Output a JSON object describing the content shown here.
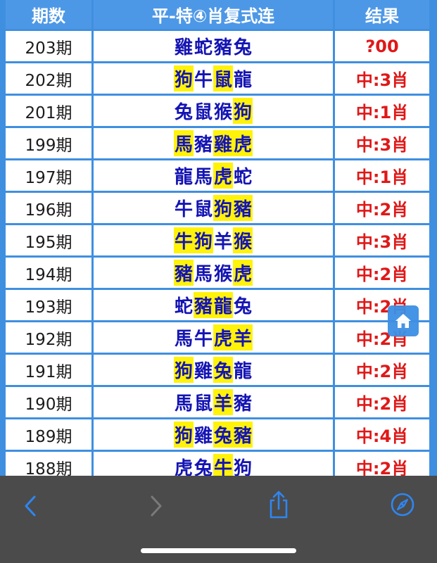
{
  "table": {
    "headers": [
      "期数",
      "平-特④肖复式连",
      "结果"
    ],
    "rows": [
      {
        "issue": "203期",
        "zodiacs": [
          {
            "c": "雞",
            "hl": false
          },
          {
            "c": "蛇",
            "hl": false
          },
          {
            "c": "豬",
            "hl": false
          },
          {
            "c": "兔",
            "hl": false
          }
        ],
        "result": "?00"
      },
      {
        "issue": "202期",
        "zodiacs": [
          {
            "c": "狗",
            "hl": true
          },
          {
            "c": "牛",
            "hl": false
          },
          {
            "c": "鼠",
            "hl": true
          },
          {
            "c": "龍",
            "hl": false
          }
        ],
        "result": "中:3肖"
      },
      {
        "issue": "201期",
        "zodiacs": [
          {
            "c": "兔",
            "hl": false
          },
          {
            "c": "鼠",
            "hl": false
          },
          {
            "c": "猴",
            "hl": false
          },
          {
            "c": "狗",
            "hl": true
          }
        ],
        "result": "中:1肖"
      },
      {
        "issue": "199期",
        "zodiacs": [
          {
            "c": "馬",
            "hl": true
          },
          {
            "c": "豬",
            "hl": false
          },
          {
            "c": "雞",
            "hl": true
          },
          {
            "c": "虎",
            "hl": true
          }
        ],
        "result": "中:3肖"
      },
      {
        "issue": "197期",
        "zodiacs": [
          {
            "c": "龍",
            "hl": false
          },
          {
            "c": "馬",
            "hl": false
          },
          {
            "c": "虎",
            "hl": true
          },
          {
            "c": "蛇",
            "hl": false
          }
        ],
        "result": "中:1肖"
      },
      {
        "issue": "196期",
        "zodiacs": [
          {
            "c": "牛",
            "hl": false
          },
          {
            "c": "鼠",
            "hl": false
          },
          {
            "c": "狗",
            "hl": true
          },
          {
            "c": "豬",
            "hl": true
          }
        ],
        "result": "中:2肖"
      },
      {
        "issue": "195期",
        "zodiacs": [
          {
            "c": "牛",
            "hl": true
          },
          {
            "c": "狗",
            "hl": true
          },
          {
            "c": "羊",
            "hl": false
          },
          {
            "c": "猴",
            "hl": true
          }
        ],
        "result": "中:3肖"
      },
      {
        "issue": "194期",
        "zodiacs": [
          {
            "c": "豬",
            "hl": true
          },
          {
            "c": "馬",
            "hl": false
          },
          {
            "c": "猴",
            "hl": false
          },
          {
            "c": "虎",
            "hl": true
          }
        ],
        "result": "中:2肖"
      },
      {
        "issue": "193期",
        "zodiacs": [
          {
            "c": "蛇",
            "hl": false
          },
          {
            "c": "豬",
            "hl": true
          },
          {
            "c": "龍",
            "hl": true
          },
          {
            "c": "兔",
            "hl": false
          }
        ],
        "result": "中:2肖"
      },
      {
        "issue": "192期",
        "zodiacs": [
          {
            "c": "馬",
            "hl": false
          },
          {
            "c": "牛",
            "hl": false
          },
          {
            "c": "虎",
            "hl": true
          },
          {
            "c": "羊",
            "hl": true
          }
        ],
        "result": "中:2肖"
      },
      {
        "issue": "191期",
        "zodiacs": [
          {
            "c": "狗",
            "hl": true
          },
          {
            "c": "雞",
            "hl": false
          },
          {
            "c": "兔",
            "hl": true
          },
          {
            "c": "龍",
            "hl": false
          }
        ],
        "result": "中:2肖"
      },
      {
        "issue": "190期",
        "zodiacs": [
          {
            "c": "馬",
            "hl": false
          },
          {
            "c": "鼠",
            "hl": false
          },
          {
            "c": "羊",
            "hl": true
          },
          {
            "c": "豬",
            "hl": false
          }
        ],
        "result": "中:2肖"
      },
      {
        "issue": "189期",
        "zodiacs": [
          {
            "c": "狗",
            "hl": true
          },
          {
            "c": "雞",
            "hl": false
          },
          {
            "c": "兔",
            "hl": true
          },
          {
            "c": "豬",
            "hl": true
          }
        ],
        "result": "中:4肖"
      },
      {
        "issue": "188期",
        "zodiacs": [
          {
            "c": "虎",
            "hl": false
          },
          {
            "c": "兔",
            "hl": false
          },
          {
            "c": "牛",
            "hl": true
          },
          {
            "c": "狗",
            "hl": false
          }
        ],
        "result": "中:2肖"
      }
    ]
  },
  "home_button": {
    "icon": "home-icon"
  },
  "toolbar": {
    "back": {
      "icon": "chevron-left-icon"
    },
    "forward": {
      "icon": "chevron-right-icon"
    },
    "share": {
      "icon": "share-icon"
    },
    "browser": {
      "icon": "compass-icon"
    }
  },
  "colors": {
    "header_bg": "#4d98e6",
    "zodiac_text": "#1414b4",
    "highlight": "#fff30a",
    "result_text": "#e01818",
    "toolbar_bg": "#4b4b4b",
    "toolbar_icon_active": "#2f86f0"
  }
}
